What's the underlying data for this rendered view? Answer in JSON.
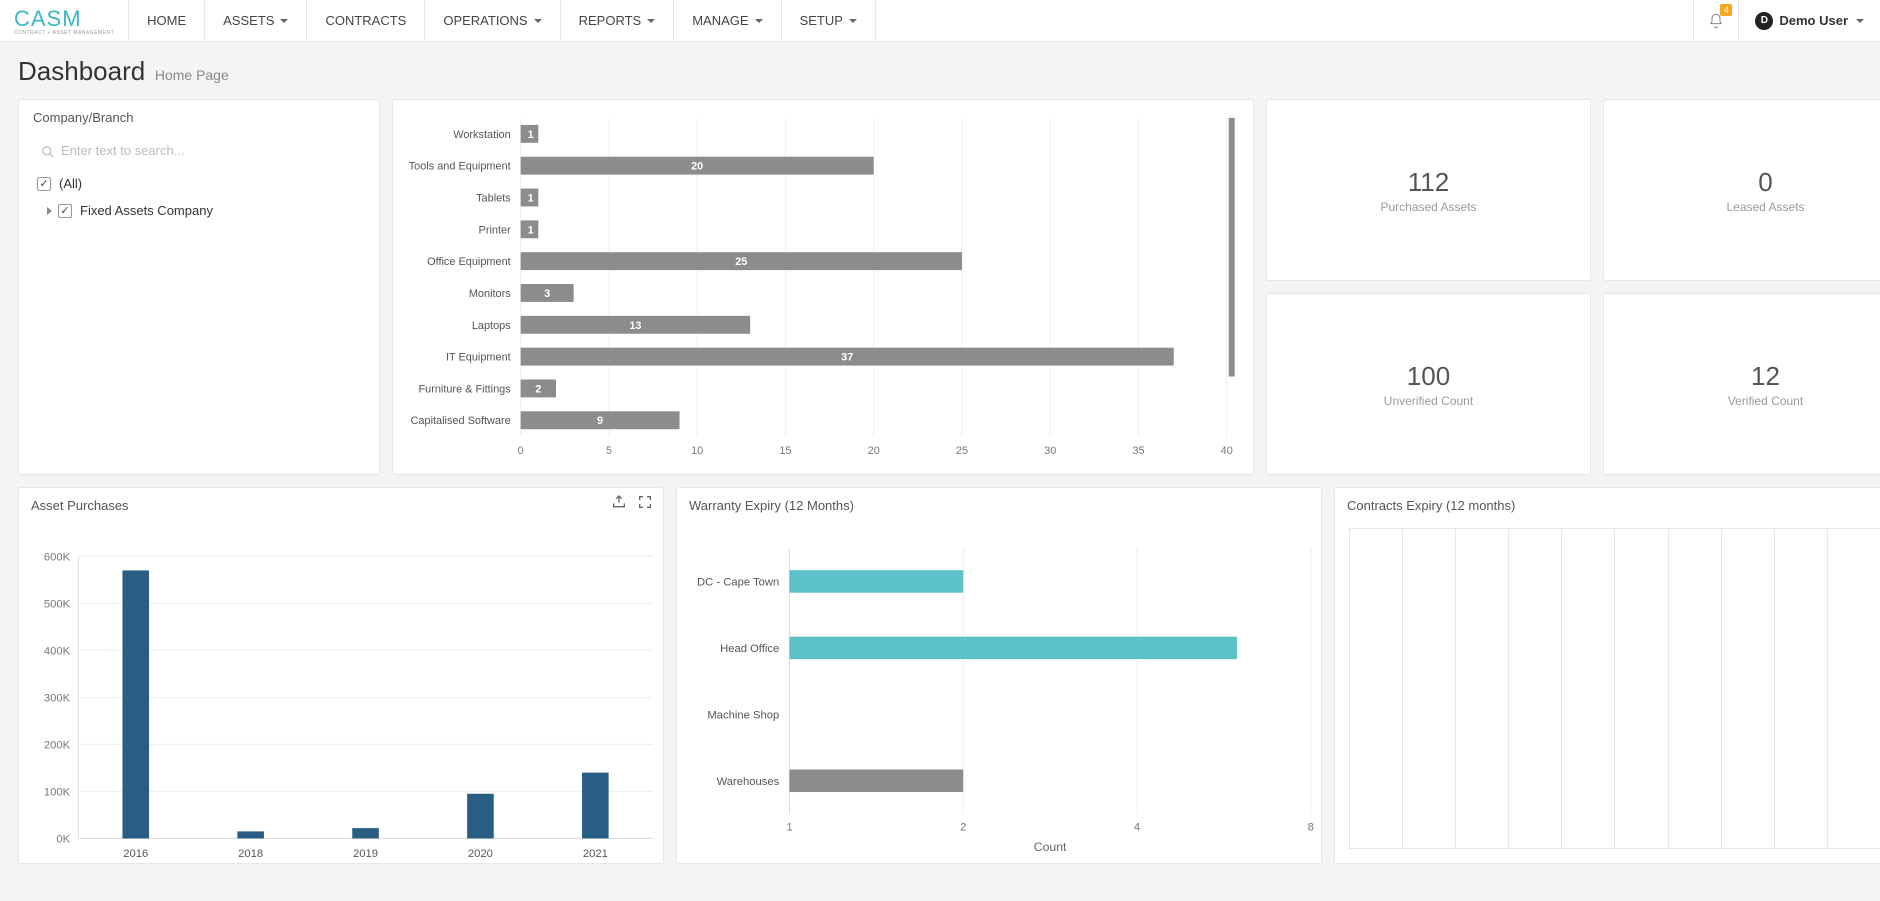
{
  "brand": {
    "name": "CASM",
    "tagline": "CONTRACT + ASSET MANAGEMENT"
  },
  "nav": {
    "items": [
      {
        "label": "HOME",
        "caret": false,
        "active": true
      },
      {
        "label": "ASSETS",
        "caret": true,
        "active": false
      },
      {
        "label": "CONTRACTS",
        "caret": false,
        "active": false
      },
      {
        "label": "OPERATIONS",
        "caret": true,
        "active": false
      },
      {
        "label": "REPORTS",
        "caret": true,
        "active": false
      },
      {
        "label": "MANAGE",
        "caret": true,
        "active": false
      },
      {
        "label": "SETUP",
        "caret": true,
        "active": false
      }
    ]
  },
  "notifications": {
    "count": "4"
  },
  "user": {
    "initial": "D",
    "name": "Demo User"
  },
  "page": {
    "title": "Dashboard",
    "subtitle": "Home Page"
  },
  "tree": {
    "title": "Company/Branch",
    "search_placeholder": "Enter text to search...",
    "nodes": [
      {
        "label": "(All)",
        "checked": true,
        "expandable": false
      },
      {
        "label": "Fixed Assets Company",
        "checked": true,
        "expandable": true
      }
    ]
  },
  "stats": [
    {
      "value": "112",
      "label": "Purchased Assets"
    },
    {
      "value": "0",
      "label": "Leased Assets"
    },
    {
      "value": "100",
      "label": "Unverified Count"
    },
    {
      "value": "12",
      "label": "Verified Count"
    }
  ],
  "cards": {
    "purchases_title": "Asset Purchases",
    "warranty_title": "Warranty Expiry (12 Months)",
    "contracts_title": "Contracts Expiry (12 months)"
  },
  "chart_data": [
    {
      "id": "assets_by_category",
      "type": "bar",
      "orientation": "horizontal",
      "categories": [
        "Workstation",
        "Tools and Equipment",
        "Tablets",
        "Printer",
        "Office Equipment",
        "Monitors",
        "Laptops",
        "IT Equipment",
        "Furniture & Fittings",
        "Capitalised Software"
      ],
      "values": [
        1,
        20,
        1,
        1,
        25,
        3,
        13,
        37,
        2,
        9
      ],
      "xlabel": "",
      "ylabel": "",
      "xlim": [
        0,
        40
      ],
      "xticks": [
        0,
        5,
        10,
        15,
        20,
        25,
        30,
        35,
        40
      ],
      "color": "#8a8c8e"
    },
    {
      "id": "asset_purchases",
      "type": "bar",
      "orientation": "vertical",
      "categories": [
        "2016",
        "2018",
        "2019",
        "2020",
        "2021"
      ],
      "values": [
        570000,
        15000,
        22000,
        95000,
        140000
      ],
      "ylim": [
        0,
        600000
      ],
      "yticks": [
        0,
        100000,
        200000,
        300000,
        400000,
        500000,
        600000
      ],
      "ytick_labels": [
        "0K",
        "100K",
        "200K",
        "300K",
        "400K",
        "500K",
        "600K"
      ],
      "color": "#2a5d84"
    },
    {
      "id": "warranty_expiry",
      "type": "bar",
      "orientation": "horizontal",
      "categories": [
        "DC - Cape Town",
        "Head Office",
        "Machine Shop",
        "Warehouses"
      ],
      "series": [
        {
          "name": "teal",
          "color": "#5cc2c9",
          "values": [
            2,
            6.3,
            0,
            0
          ]
        },
        {
          "name": "grey",
          "color": "#8a8c8e",
          "values": [
            0,
            0,
            0,
            2
          ]
        }
      ],
      "xlabel": "Count",
      "xlim": [
        1,
        8
      ],
      "xticks": [
        1,
        2,
        4,
        8
      ]
    },
    {
      "id": "contracts_expiry",
      "type": "bar",
      "orientation": "vertical",
      "categories": [],
      "values": [],
      "columns": 10
    }
  ]
}
